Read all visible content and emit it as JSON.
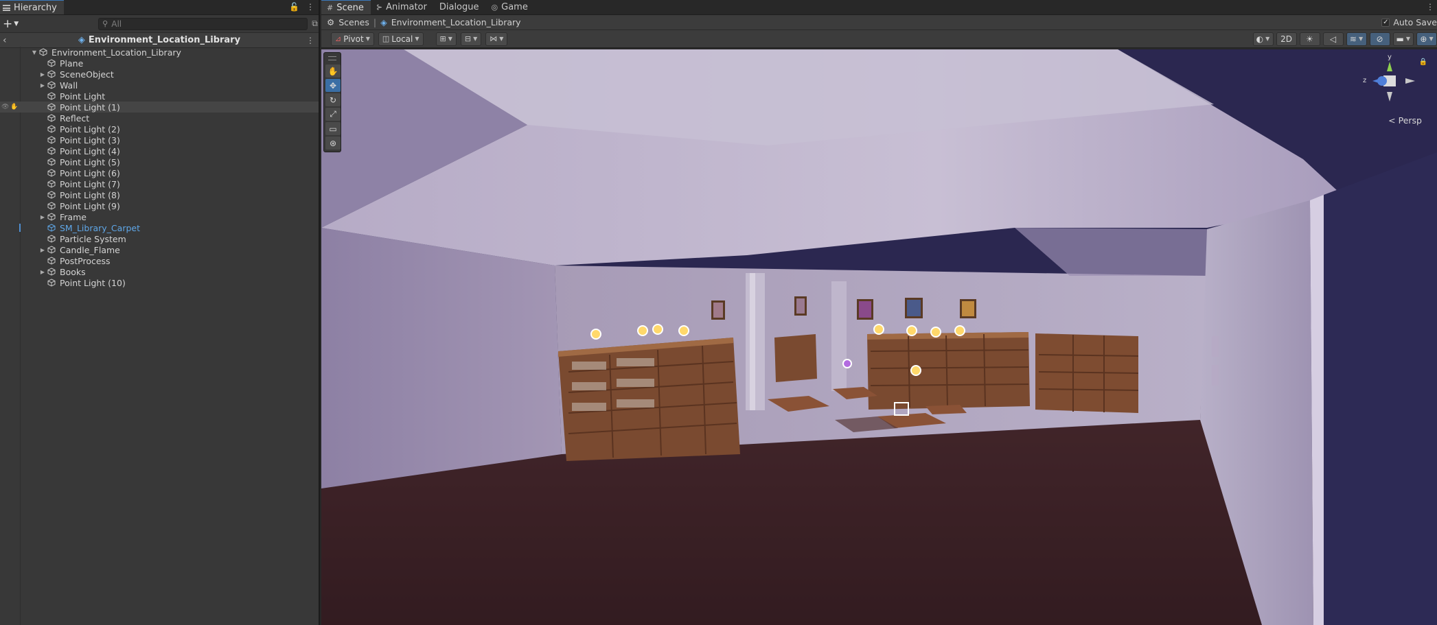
{
  "hierarchy": {
    "tab_label": "Hierarchy",
    "search_placeholder": "All",
    "scene_name": "Environment_Location_Library",
    "root": "Environment_Location_Library",
    "items": [
      {
        "label": "Plane",
        "expandable": false
      },
      {
        "label": "SceneObject",
        "expandable": true
      },
      {
        "label": "Wall",
        "expandable": true
      },
      {
        "label": "Point Light",
        "expandable": false
      },
      {
        "label": "Point Light (1)",
        "expandable": false
      },
      {
        "label": "Reflect",
        "expandable": false
      },
      {
        "label": "Point Light (2)",
        "expandable": false
      },
      {
        "label": "Point Light (3)",
        "expandable": false
      },
      {
        "label": "Point Light (4)",
        "expandable": false
      },
      {
        "label": "Point Light (5)",
        "expandable": false
      },
      {
        "label": "Point Light (6)",
        "expandable": false
      },
      {
        "label": "Point Light (7)",
        "expandable": false
      },
      {
        "label": "Point Light (8)",
        "expandable": false
      },
      {
        "label": "Point Light (9)",
        "expandable": false
      },
      {
        "label": "Frame",
        "expandable": true
      },
      {
        "label": "SM_Library_Carpet",
        "expandable": false
      },
      {
        "label": "Particle System",
        "expandable": false
      },
      {
        "label": "Candle_Flame",
        "expandable": true
      },
      {
        "label": "PostProcess",
        "expandable": false
      },
      {
        "label": "Books",
        "expandable": true
      },
      {
        "label": "Point Light (10)",
        "expandable": false
      }
    ]
  },
  "tabs": [
    {
      "label": "Scene",
      "icon": "grid-icon"
    },
    {
      "label": "Animator",
      "icon": "animator-icon"
    },
    {
      "label": "Dialogue",
      "icon": ""
    },
    {
      "label": "Game",
      "icon": "gamepad-icon"
    }
  ],
  "breadcrumb": {
    "root": "Scenes",
    "current": "Environment_Location_Library",
    "autosave_label": "Auto Save"
  },
  "toolbar": {
    "pivot": "Pivot",
    "local": "Local",
    "mode_2d": "2D"
  },
  "viewport": {
    "projection_label": "Persp",
    "gizmo_y": "y",
    "gizmo_z": "z"
  },
  "colors": {
    "accent": "#3a79bb",
    "selected_text": "#5fa7e8"
  }
}
